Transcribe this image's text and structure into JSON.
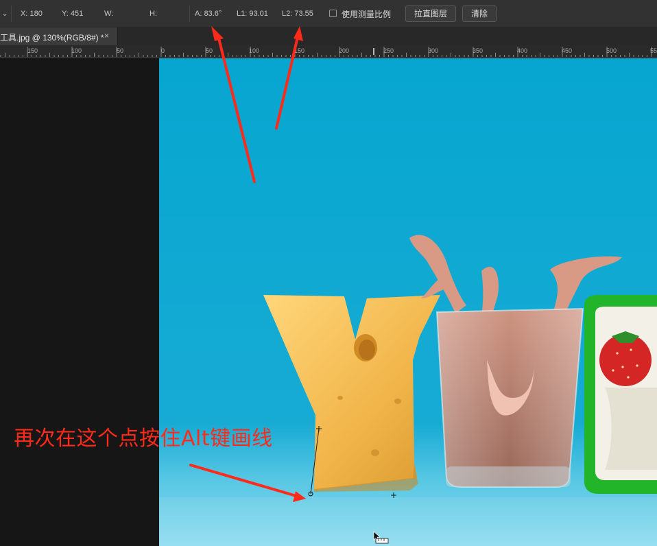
{
  "options_bar": {
    "x_label": "X:",
    "x_value": "180",
    "y_label": "Y:",
    "y_value": "451",
    "w_label": "W:",
    "h_label": "H:",
    "a_label": "A:",
    "a_value": "83.6°",
    "l1_label": "L1:",
    "l1_value": "93.01",
    "l2_label": "L2:",
    "l2_value": "73.55",
    "scale_checkbox_label": "使用测量比例",
    "straighten_button": "拉直图层",
    "clear_button": "清除"
  },
  "document_tab": {
    "title": "工具.jpg @ 130%(RGB/8#) *",
    "close_glyph": "×"
  },
  "ruler": {
    "labels": [
      "150",
      "100",
      "50",
      "0",
      "50",
      "100",
      "150",
      "200",
      "250",
      "300",
      "350",
      "400",
      "450",
      "500",
      "55"
    ]
  },
  "annotation": {
    "text": "再次在这个点按住Alt键画线"
  },
  "colors": {
    "annotation_red": "#ff2a1a",
    "canvas_bg": "#0aa6d0",
    "ui_dark": "#323232"
  },
  "icons": {
    "dropdown": "chevron-down-icon",
    "close": "close-icon",
    "cursor": "ruler-cursor-icon"
  }
}
